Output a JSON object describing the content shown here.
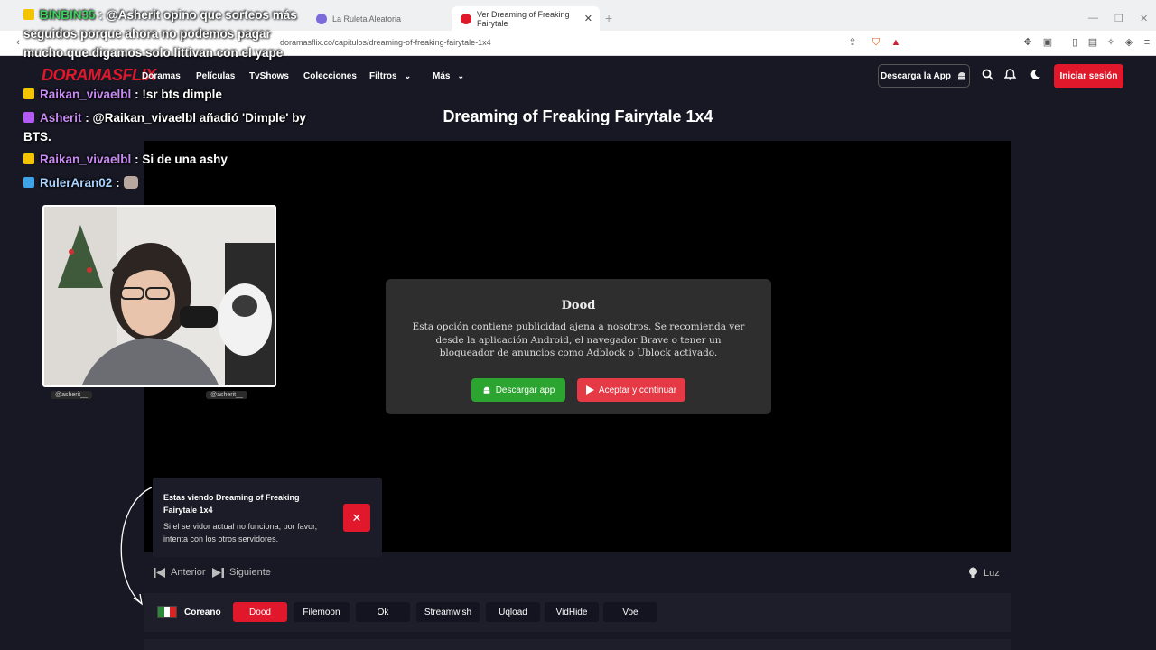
{
  "browser": {
    "tabs": [
      {
        "title": "La Ruleta Aleatoria",
        "active": false
      },
      {
        "title": "Ver Dreaming of Freaking Fairytale",
        "active": true
      }
    ],
    "url": "doramasflix.co/capitulos/dreaming-of-freaking-fairytale-1x4"
  },
  "site": {
    "logo": "DORAMASFLIX",
    "nav": [
      {
        "label": "Doramas"
      },
      {
        "label": "Películas"
      },
      {
        "label": "TvShows"
      },
      {
        "label": "Colecciones"
      },
      {
        "label": "Filtros"
      },
      {
        "label": "Más"
      }
    ],
    "app_button": "Descarga la App",
    "login_button": "Iniciar sesión",
    "accent": "#e1182b"
  },
  "page_title": "Dreaming of Freaking Fairytale 1x4",
  "modal": {
    "title": "Dood",
    "text": "Esta opción contiene publicidad ajena a nosotros. Se recomienda ver desde la aplicación Android, el navegador Brave o tener un bloqueador de anuncios como Adblock o Ublock activado.",
    "download_button": "Descargar app",
    "accept_button": "Aceptar y continuar"
  },
  "toast": {
    "title": "Estas viendo Dreaming of Freaking Fairytale 1x4",
    "text": "Si el servidor actual no funciona, por favor, intenta con los otros servidores."
  },
  "episode_nav": {
    "prev": "Anterior",
    "next": "Siguiente",
    "light": "Luz"
  },
  "servers": {
    "language": "Coreano",
    "options": [
      "Dood",
      "Filemoon",
      "Ok",
      "Streamwish",
      "Uqload",
      "VidHide",
      "Voe"
    ],
    "selected": "Dood"
  },
  "chat": [
    {
      "user": "BINBIN35",
      "text": ": @Asherit opino que sorteos más seguidos porque ahora no podemos pagar mucho que digamos solo littivan con el yape"
    },
    {
      "user": "Raikan_vivaelbl",
      "text": ": !sr bts dimple"
    },
    {
      "user": "Asherit",
      "text": ": @Raikan_vivaelbl añadió 'Dimple' by BTS."
    },
    {
      "user": "Raikan_vivaelbl",
      "text": ": Si de una ashy"
    },
    {
      "user": "RulerAran02",
      "text": ":"
    }
  ],
  "stream": {
    "handle_1": "@asherit__",
    "handle_2": "@asherit__"
  }
}
